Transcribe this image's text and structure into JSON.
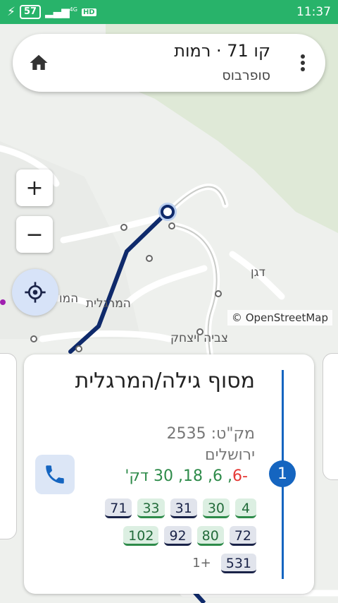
{
  "status_bar": {
    "battery": "57",
    "network": "4G",
    "hd": "HD",
    "time": "11:37"
  },
  "header": {
    "title": "קו 71 · רמות",
    "subtitle": "סופרבוס",
    "home_icon": "home-icon",
    "menu_icon": "more-vert-icon"
  },
  "map": {
    "zoom_in": "+",
    "zoom_out": "−",
    "attribution": "© OpenStreetMap",
    "labels": {
      "dagan": "דגן",
      "hamargalit": "המרגלית",
      "hamo": "המו",
      "tzvia": "צביה ויצחק"
    }
  },
  "stop_card": {
    "index": "1",
    "name": "מסוף גילה/המרגלית",
    "code": "מק\"ט: 2535",
    "city": "ירושלים",
    "times_red": "-6",
    "times_green": ", 6, 18, 30 דק'",
    "lines_row1": [
      "4",
      "30",
      "31",
      "33",
      "71"
    ],
    "lines_row2": [
      "72",
      "80",
      "92",
      "102"
    ],
    "lines_row3": [
      "531"
    ],
    "more": "+1"
  },
  "colors": {
    "status_bar": "#28b36a",
    "route": "#0f2a6b",
    "accent": "#1565c0",
    "eta_red": "#e53935",
    "eta_green": "#2e8b4a"
  }
}
